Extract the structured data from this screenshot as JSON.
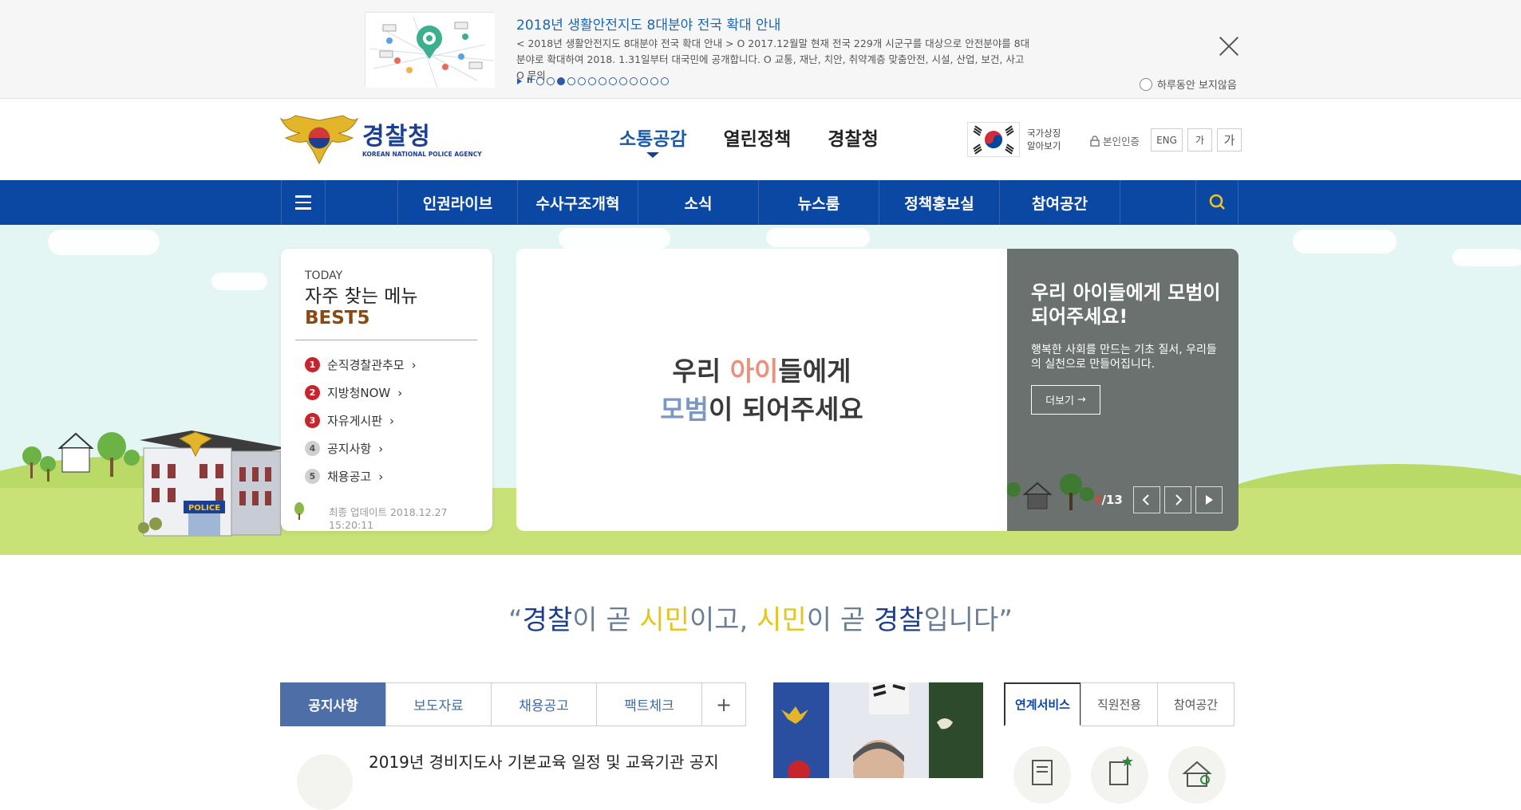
{
  "popup": {
    "title": "2018년 생활안전지도 8대분야 전국 확대 안내",
    "body": "< 2018년 생활안전지도 8대분야 전국 확대 안내 > O 2017.12월말 현재 전국 229개 시군구를 대상으로 안전분야를 8대분야로 확대하여 2018. 1.31일부터 대국민에 공개합니다. O 교통, 재난, 치안, 취약계층 맞춤안전, 시설, 산업, 보건, 사고 O 문의",
    "dots_total": 13,
    "dots_active_index": 2,
    "no_show_label": "하루동안 보지않음"
  },
  "header": {
    "logo_kr": "경찰청",
    "logo_en": "KOREAN NATIONAL POLICE AGENCY",
    "gnb": [
      "소통공감",
      "열린정책",
      "경찰청"
    ],
    "gnb_active": 0,
    "flag_label_1": "국가상징",
    "flag_label_2": "알아보기",
    "auth_label": "본인인증",
    "util": [
      "ENG",
      "가",
      "가"
    ]
  },
  "nav": {
    "items": [
      "인권라이브",
      "수사구조개혁",
      "소식",
      "뉴스룸",
      "정책홍보실",
      "참여공간"
    ]
  },
  "best": {
    "today": "TODAY",
    "title": "자주 찾는 메뉴",
    "best5": "BEST5",
    "items": [
      {
        "num": "1",
        "label": "순직경찰관추모"
      },
      {
        "num": "2",
        "label": "지방청NOW"
      },
      {
        "num": "3",
        "label": "자유게시판"
      },
      {
        "num": "4",
        "label": "공지사항"
      },
      {
        "num": "5",
        "label": "채용공고"
      }
    ],
    "updated": "최종 업데이트 2018.12.27 15:20:11"
  },
  "slide": {
    "line1_pre": "우리 ",
    "line1_hl": "아이",
    "line1_post": "들에게",
    "line2_hl": "모범",
    "line2_post": "이 되어주세요",
    "side_title": "우리 아이들에게 모범이 되어주세요!",
    "side_desc": "행복한 사회를 만드는 기초 질서, 우리들의 실천으로 만들어집니다.",
    "more_label": "더보기",
    "current": "3",
    "total": "/13"
  },
  "slogan": {
    "q_open": "“",
    "w1": "경찰",
    "t1": "이 곧 ",
    "w2": "시민",
    "t2": "이고, ",
    "w3": "시민",
    "t3": "이 곧 ",
    "w4": "경찰",
    "t4": "입니다",
    "q_close": "”"
  },
  "tabs": [
    "공지사항",
    "보도자료",
    "채용공고",
    "팩트체크"
  ],
  "tabs_plus": "+",
  "news": {
    "first": "2019년 경비지도사 기본교육 일정 및 교육기관 공지"
  },
  "service_tabs": [
    "연계서비스",
    "직원전용",
    "참여공간"
  ],
  "colors": {
    "brand_blue": "#0b48a4",
    "accent_yellow": "#e8c318",
    "best_red": "#c7242b"
  }
}
